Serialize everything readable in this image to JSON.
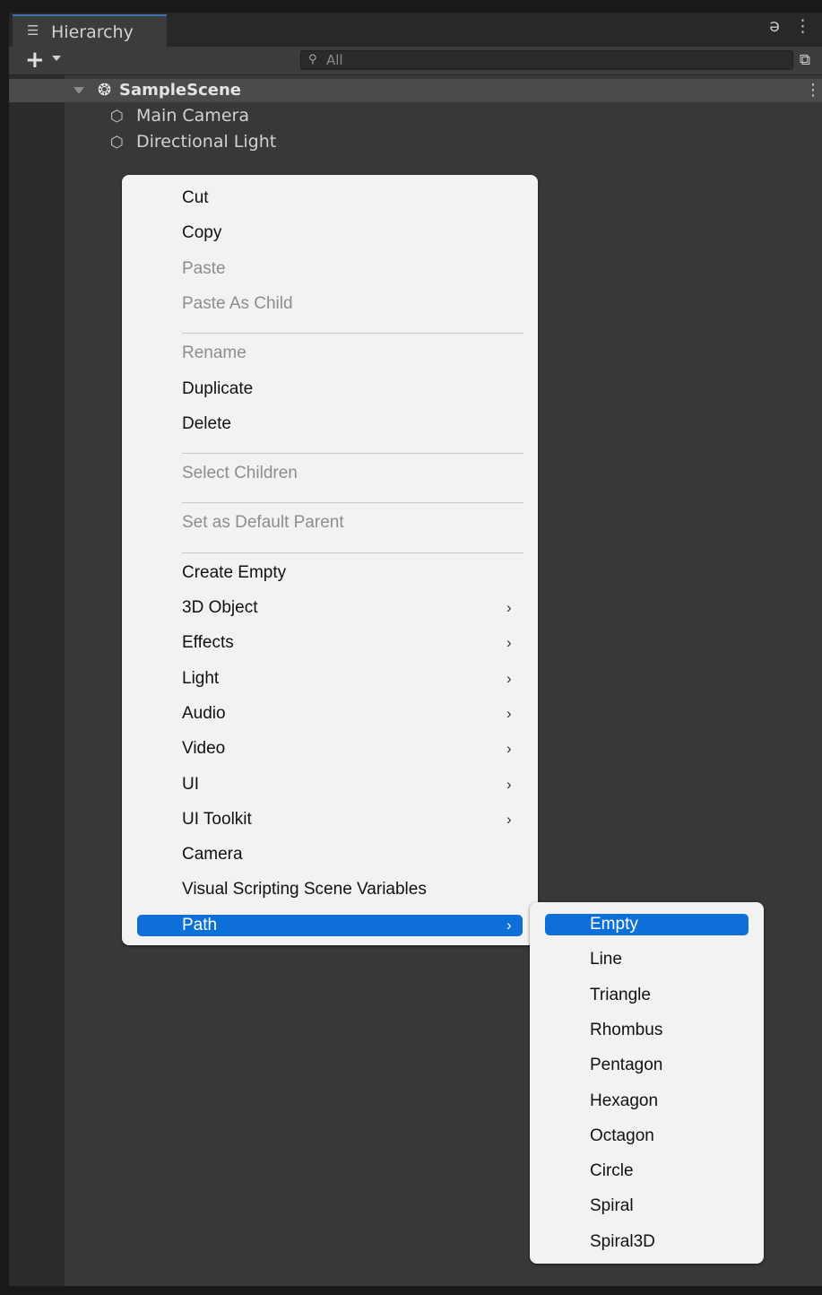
{
  "window": {
    "tab_label": "Hierarchy",
    "tab_icon": "list-icon",
    "lock_icon": "lock-icon",
    "more_icon": "kebab-menu-icon"
  },
  "toolbar": {
    "add_label": "+",
    "search_placeholder": "All",
    "search_value": "",
    "scene_view_icon": "scene-view-icon"
  },
  "hierarchy": {
    "scene_name": "SampleScene",
    "items": [
      {
        "label": "Main Camera",
        "icon": "gameobject-cube-icon"
      },
      {
        "label": "Directional Light",
        "icon": "gameobject-cube-icon"
      }
    ]
  },
  "context_menu": {
    "groups": [
      [
        {
          "label": "Cut",
          "enabled": true
        },
        {
          "label": "Copy",
          "enabled": true
        },
        {
          "label": "Paste",
          "enabled": false
        },
        {
          "label": "Paste As Child",
          "enabled": false
        }
      ],
      [
        {
          "label": "Rename",
          "enabled": false
        },
        {
          "label": "Duplicate",
          "enabled": true
        },
        {
          "label": "Delete",
          "enabled": true
        }
      ],
      [
        {
          "label": "Select Children",
          "enabled": false
        }
      ],
      [
        {
          "label": "Set as Default Parent",
          "enabled": false
        }
      ],
      [
        {
          "label": "Create Empty",
          "enabled": true,
          "submenu": false
        },
        {
          "label": "3D Object",
          "enabled": true,
          "submenu": true
        },
        {
          "label": "Effects",
          "enabled": true,
          "submenu": true
        },
        {
          "label": "Light",
          "enabled": true,
          "submenu": true
        },
        {
          "label": "Audio",
          "enabled": true,
          "submenu": true
        },
        {
          "label": "Video",
          "enabled": true,
          "submenu": true
        },
        {
          "label": "UI",
          "enabled": true,
          "submenu": true
        },
        {
          "label": "UI Toolkit",
          "enabled": true,
          "submenu": true
        },
        {
          "label": "Camera",
          "enabled": true,
          "submenu": false
        },
        {
          "label": "Visual Scripting Scene Variables",
          "enabled": true,
          "submenu": false
        },
        {
          "label": "Path",
          "enabled": true,
          "submenu": true,
          "selected": true
        }
      ]
    ]
  },
  "path_submenu": {
    "items": [
      {
        "label": "Empty",
        "selected": true
      },
      {
        "label": "Line"
      },
      {
        "label": "Triangle"
      },
      {
        "label": "Rhombus"
      },
      {
        "label": "Pentagon"
      },
      {
        "label": "Hexagon"
      },
      {
        "label": "Octagon"
      },
      {
        "label": "Circle"
      },
      {
        "label": "Spiral"
      },
      {
        "label": "Spiral3D"
      }
    ]
  },
  "colors": {
    "highlight": "#0e6fd8",
    "menu_bg": "#f2f2f2",
    "panel_bg": "#383838",
    "disabled_text": "#8d8d8d"
  }
}
